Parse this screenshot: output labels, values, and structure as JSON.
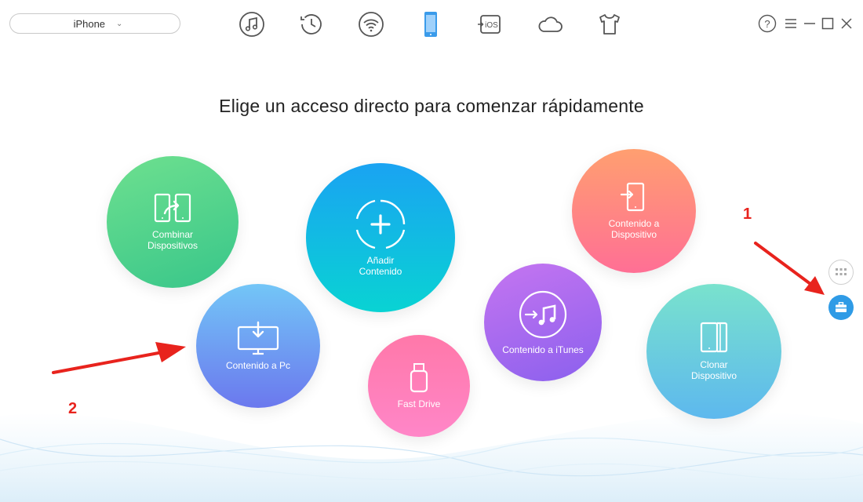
{
  "device": {
    "name": "iPhone",
    "icon": "apple-logo-icon",
    "dropdown_icon": "chevron-down-icon"
  },
  "toolbar": {
    "items": [
      {
        "name": "audio-manager",
        "icon": "music-note-icon"
      },
      {
        "name": "backup-history",
        "icon": "clock-history-icon"
      },
      {
        "name": "wifi-transfer",
        "icon": "wifi-icon"
      },
      {
        "name": "device-manager",
        "icon": "phone-icon",
        "active": true
      },
      {
        "name": "ios-mover",
        "icon": "ios-transfer-icon",
        "label": "iOS"
      },
      {
        "name": "icloud-manager",
        "icon": "cloud-icon"
      },
      {
        "name": "toolkit",
        "icon": "tshirt-icon"
      }
    ],
    "active_color": "#3a9bea"
  },
  "window": {
    "help": "help-icon",
    "menu": "menu-icon",
    "minimize": "minimize-icon",
    "maximize": "maximize-icon",
    "close": "close-icon"
  },
  "headline": "Elige un acceso directo para comenzar rápidamente",
  "shortcuts": {
    "combinar": {
      "line1": "Combinar",
      "line2": "Dispositivos",
      "icon": "merge-devices-icon"
    },
    "anadir": {
      "line1": "Añadir",
      "line2": "Contenido",
      "icon": "add-content-icon"
    },
    "contenido_dispositivo": {
      "line1": "Contenido a",
      "line2": "Dispositivo",
      "icon": "content-to-device-icon"
    },
    "contenido_pc": {
      "line1": "Contenido a Pc",
      "icon": "content-to-pc-icon"
    },
    "contenido_itunes": {
      "line1": "Contenido a iTunes",
      "icon": "content-to-itunes-icon"
    },
    "fast_drive": {
      "line1": "Fast Drive",
      "icon": "usb-drive-icon"
    },
    "clonar": {
      "line1": "Clonar",
      "line2": "Dispositivo",
      "icon": "clone-device-icon"
    }
  },
  "side_buttons": {
    "grid": "grid-view-icon",
    "tools": "toolbox-icon"
  },
  "annotations": {
    "one": "1",
    "two": "2"
  },
  "colors": {
    "annotation_red": "#e8231d",
    "side_active": "#2f9be6"
  }
}
